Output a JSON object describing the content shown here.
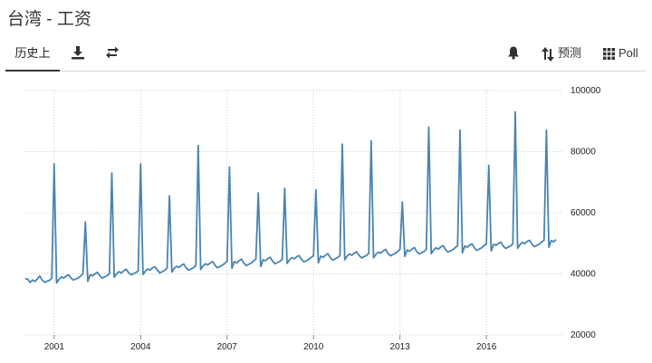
{
  "page": {
    "title": "台湾 - 工资"
  },
  "toolbar": {
    "history_label": "历史上",
    "forecast_label": "预测",
    "poll_label": "Poll",
    "icons": [
      "download-icon",
      "compare-icon",
      "bell-icon",
      "sort-icon",
      "grid-icon"
    ]
  },
  "colors": {
    "line": "#4a84b0",
    "grid": "#cccccc"
  },
  "chart_data": {
    "type": "line",
    "title": "",
    "xlabel": "",
    "ylabel": "",
    "ylim": [
      20000,
      100000
    ],
    "yticks": [
      20000,
      40000,
      60000,
      80000,
      100000
    ],
    "ytick_labels": [
      "20000",
      "40000",
      "60000",
      "80000",
      "100000"
    ],
    "xticks": [
      2001,
      2004,
      2007,
      2010,
      2013,
      2016
    ],
    "xtick_labels": [
      "2001",
      "2004",
      "2007",
      "2010",
      "2013",
      "2016"
    ],
    "xlim": [
      "2000-01",
      "2018-09"
    ],
    "grid": true,
    "series": [
      {
        "name": "",
        "start": "2000-01",
        "frequency": "monthly",
        "base": [
          38500,
          38200,
          37200,
          38000,
          37500,
          38300,
          39300,
          38000,
          37200,
          37600,
          37800,
          38600,
          39000,
          38500,
          38200,
          39000,
          38600,
          39300,
          39700,
          38600,
          38000,
          38300,
          38600,
          39300,
          40000,
          39600,
          39000,
          39700,
          39400,
          40000,
          40500,
          39400,
          38600,
          39000,
          39400,
          40000,
          40800,
          40400,
          40000,
          40700,
          40300,
          41000,
          41500,
          40400,
          39700,
          40000,
          40400,
          41000,
          41800,
          41300,
          40900,
          41600,
          41200,
          42000,
          42300,
          41200,
          40300,
          40700,
          41100,
          41900,
          42600,
          42100,
          41800,
          42500,
          42100,
          42800,
          43200,
          41900,
          41200,
          41600,
          42000,
          42700,
          43400,
          42900,
          42600,
          43300,
          42900,
          43600,
          44000,
          42800,
          42000,
          42400,
          42800,
          43400,
          44100,
          43600,
          43300,
          44000,
          43600,
          44300,
          44800,
          43500,
          42700,
          43100,
          43500,
          44200,
          44800,
          44200,
          43900,
          44600,
          44300,
          45000,
          45400,
          44100,
          43300,
          43700,
          44100,
          44800,
          45400,
          44900,
          44600,
          45300,
          44900,
          45600,
          46000,
          44700,
          43900,
          44300,
          44700,
          45400,
          45900,
          45400,
          45100,
          45800,
          45400,
          46100,
          46600,
          45300,
          44500,
          44900,
          45300,
          46000,
          46600,
          46100,
          45800,
          46500,
          46100,
          46800,
          47200,
          46000,
          45200,
          45600,
          46000,
          46700,
          47200,
          46700,
          46400,
          47100,
          46800,
          47500,
          48000,
          46700,
          45900,
          46300,
          46700,
          47300,
          48000,
          47500,
          47200,
          47800,
          47400,
          48100,
          48600,
          47300,
          46500,
          46900,
          47300,
          48000,
          48600,
          48100,
          47800,
          48500,
          48100,
          48800,
          49200,
          47900,
          47100,
          47500,
          47900,
          48600,
          49200,
          48700,
          48400,
          49100,
          48700,
          49400,
          49800,
          48500,
          47700,
          48100,
          48500,
          49200,
          49800,
          49300,
          49000,
          49700,
          49300,
          50000,
          50400,
          49100,
          48300,
          48700,
          49100,
          49800,
          50400,
          49900,
          49600,
          50300,
          49900,
          50600,
          51000,
          49700,
          48900,
          49300,
          49700,
          50400,
          51000,
          50500,
          50200,
          50900,
          50500,
          51200,
          51600,
          50300,
          49500,
          49900,
          50300,
          51000
        ],
        "spikes": [
          {
            "date": "2001-01",
            "value": 76000
          },
          {
            "date": "2002-02",
            "value": 57000
          },
          {
            "date": "2003-01",
            "value": 73000
          },
          {
            "date": "2004-01",
            "value": 76000
          },
          {
            "date": "2005-01",
            "value": 65500
          },
          {
            "date": "2006-01",
            "value": 82000
          },
          {
            "date": "2007-02",
            "value": 75000
          },
          {
            "date": "2008-02",
            "value": 66500
          },
          {
            "date": "2009-01",
            "value": 68000
          },
          {
            "date": "2010-02",
            "value": 67500
          },
          {
            "date": "2011-01",
            "value": 82500
          },
          {
            "date": "2012-01",
            "value": 83500
          },
          {
            "date": "2013-02",
            "value": 63500
          },
          {
            "date": "2014-01",
            "value": 88000
          },
          {
            "date": "2015-02",
            "value": 87000
          },
          {
            "date": "2016-02",
            "value": 75500
          },
          {
            "date": "2017-01",
            "value": 93000
          },
          {
            "date": "2018-02",
            "value": 87000
          }
        ],
        "end": "2018-06"
      }
    ]
  }
}
